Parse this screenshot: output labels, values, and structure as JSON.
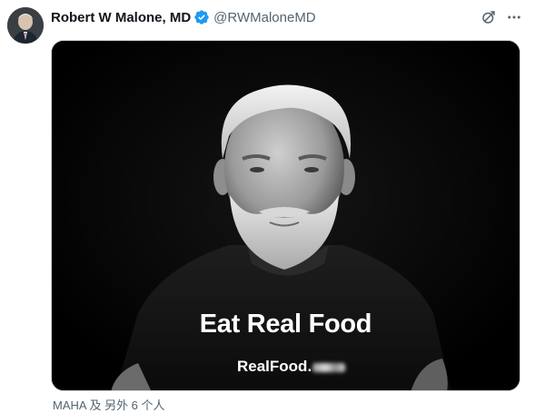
{
  "post": {
    "author": {
      "display_name": "Robert W Malone, MD",
      "handle": "@RWMaloneMD",
      "verified": true,
      "avatar": "author-avatar"
    },
    "actions": {
      "grok_icon": "grok-icon",
      "more_icon": "more-icon"
    },
    "media": {
      "headline": "Eat Real Food",
      "site_text": "RealFood."
    },
    "tagged_text": "MAHA 及 另外 6 个人"
  },
  "colors": {
    "verified_badge": "#1d9bf0",
    "secondary_text": "#536471",
    "primary_text": "#0f1419",
    "media_background": "#050505"
  }
}
